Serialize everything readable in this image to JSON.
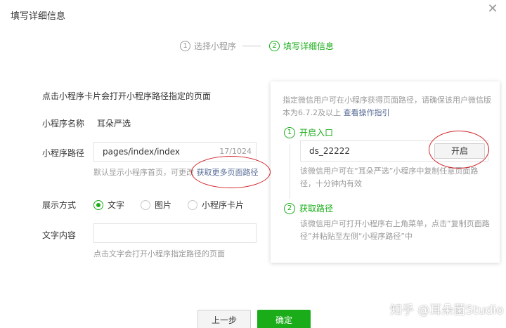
{
  "dialog": {
    "title": "填写详细信息"
  },
  "steps": [
    {
      "num": "1",
      "label": "选择小程序"
    },
    {
      "num": "2",
      "label": "填写详细信息"
    }
  ],
  "form": {
    "hint": "点击小程序卡片会打开小程序路径指定的页面",
    "name_label": "小程序名称",
    "name_value": "耳朵严选",
    "path_label": "小程序路径",
    "path_value": "pages/index/index",
    "path_count": "17/1024",
    "path_hint": "默认显示小程序首页，可更改",
    "path_link": "获取更多页面路径",
    "display_label": "展示方式",
    "display_options": [
      "文字",
      "图片",
      "小程序卡片"
    ],
    "text_label": "文字内容",
    "text_value": "",
    "text_hint": "点击文字会打开小程序指定路径的页面"
  },
  "panel": {
    "intro": "指定微信用户可在小程序获得页面路径，请确保该用户微信版本为6.7.2及以上",
    "intro_link": "查看操作指引",
    "step1_num": "1",
    "step1_title": "开启入口",
    "wechat_id": "ds_22222",
    "open_button": "开启",
    "step1_desc": "该微信用户可在“耳朵严选”小程序中复制任意页面路径，十分钟内有效",
    "step2_num": "2",
    "step2_title": "获取路径",
    "step2_desc": "该微信用户可打开小程序右上角菜单，点击“复制页面路径”并粘贴至左侧“小程序路径”中"
  },
  "footer": {
    "prev": "上一步",
    "ok": "确定"
  },
  "watermark": "知乎 @耳朵菌Studio",
  "colors": {
    "accent": "#1aad19",
    "link": "#576b95",
    "annotation": "#d0252a"
  }
}
